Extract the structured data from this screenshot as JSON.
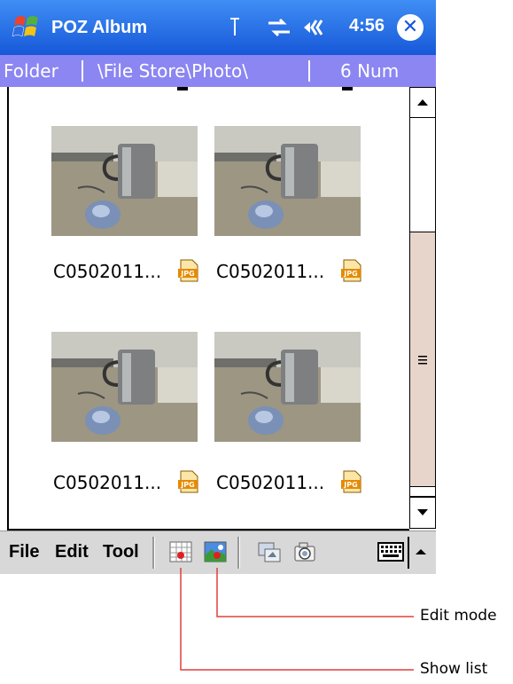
{
  "titlebar": {
    "app_title": "POZ Album",
    "clock": "4:56",
    "close_symbol": "✕"
  },
  "pathbar": {
    "folder_label": "Folder",
    "path": "\\File Store\\Photo\\",
    "count": "6 Num"
  },
  "photos": [
    {
      "caption": "C0502011..."
    },
    {
      "caption": "C0502011..."
    },
    {
      "caption": "C0502011..."
    },
    {
      "caption": "C0502011..."
    }
  ],
  "menu": {
    "file": "File",
    "edit": "Edit",
    "tool": "Tool"
  },
  "callouts": {
    "edit_mode": "Edit mode",
    "show_list": "Show list"
  },
  "colors": {
    "title_bg": "#1758d8",
    "path_bg": "#8b86f2",
    "callout_line": "#e0403b"
  }
}
